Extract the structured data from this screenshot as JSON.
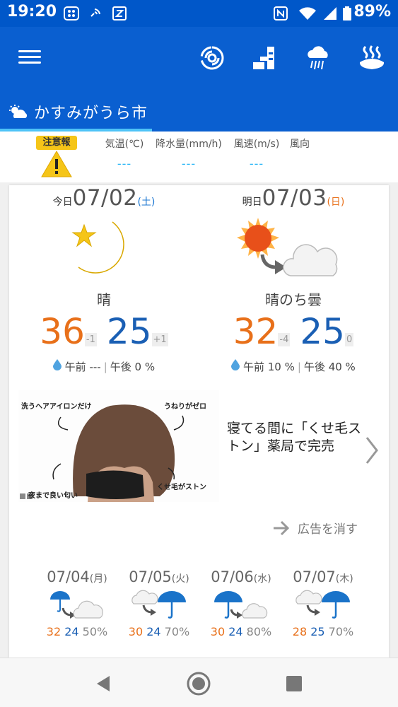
{
  "status_bar": {
    "time": "19:20",
    "battery": "89%"
  },
  "header": {
    "location": "かすみがうら市"
  },
  "info_strip": {
    "alert_label": "注意報",
    "columns": [
      {
        "label": "気温(℃)",
        "value": "---"
      },
      {
        "label": "降水量(mm/h)",
        "value": "---"
      },
      {
        "label": "風速(m/s)",
        "value": "---"
      },
      {
        "label": "風向",
        "value": ""
      }
    ]
  },
  "today": {
    "prefix": "今日",
    "date": "07/02",
    "dow": "(土)",
    "weather": "晴",
    "high": "36",
    "high_diff": "-1",
    "low": "25",
    "low_diff": "+1",
    "rain_am": "午前 ---",
    "rain_pm": "午後 0 %",
    "icon": "moon-star-icon"
  },
  "tomorrow": {
    "prefix": "明日",
    "date": "07/03",
    "dow": "(日)",
    "weather": "晴のち曇",
    "high": "32",
    "high_diff": "-4",
    "low": "25",
    "low_diff": "0",
    "rain_am": "午前 10 %",
    "rain_pm": "午後 40 %",
    "icon": "sun-then-cloud-icon"
  },
  "ad": {
    "captions": [
      "洗うヘアアイロンだけ",
      "うねりがゼロ",
      "夜まで良い匂い",
      "くせ毛がストン"
    ],
    "title": "寝てる間に「くせ毛ストン」薬局で完売",
    "hide_label": "広告を消す"
  },
  "weekly": [
    {
      "date": "07/04",
      "dow": "(月)",
      "high": "32",
      "low": "24",
      "pop": "50%",
      "icon": "rain-then-cloud-icon"
    },
    {
      "date": "07/05",
      "dow": "(火)",
      "high": "30",
      "low": "24",
      "pop": "70%",
      "icon": "cloud-then-rain-icon"
    },
    {
      "date": "07/06",
      "dow": "(水)",
      "high": "30",
      "low": "24",
      "pop": "80%",
      "icon": "rain-then-cloud-icon"
    },
    {
      "date": "07/07",
      "dow": "(木)",
      "high": "28",
      "low": "25",
      "pop": "70%",
      "icon": "cloud-then-rain-icon"
    }
  ],
  "colors": {
    "appbar": "#0a5fd0",
    "statusbar": "#0057c9",
    "high": "#e8701a",
    "low": "#1a5fb4",
    "accent": "#4fc3f7"
  }
}
